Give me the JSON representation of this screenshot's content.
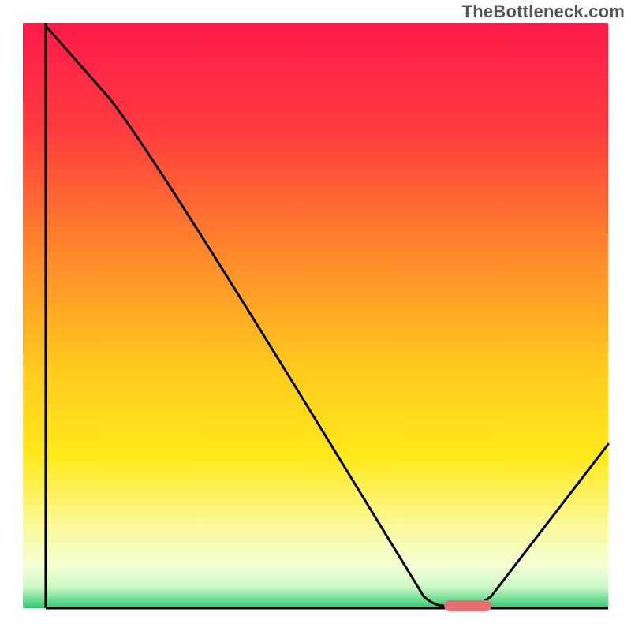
{
  "watermark": "TheBottleneck.com",
  "chart_data": {
    "type": "line",
    "title": "",
    "xlabel": "",
    "ylabel": "",
    "x_range": [
      0,
      100
    ],
    "y_range": [
      0,
      100
    ],
    "gradient_stops": [
      {
        "offset": 0.0,
        "color": "#ff1a4a"
      },
      {
        "offset": 0.18,
        "color": "#ff3a3f"
      },
      {
        "offset": 0.4,
        "color": "#ff8a2a"
      },
      {
        "offset": 0.58,
        "color": "#ffc71f"
      },
      {
        "offset": 0.74,
        "color": "#ffe91a"
      },
      {
        "offset": 0.86,
        "color": "#fbf99a"
      },
      {
        "offset": 0.93,
        "color": "#f3ffd6"
      },
      {
        "offset": 0.965,
        "color": "#c9f7c4"
      },
      {
        "offset": 1.0,
        "color": "#2ecc71"
      }
    ],
    "curve": {
      "name": "bottleneck",
      "x": [
        3.9,
        22,
        68.5,
        72,
        76,
        80,
        100
      ],
      "y": [
        99.5,
        78,
        2.0,
        0.4,
        0.4,
        2.0,
        28
      ]
    },
    "optimal_band": {
      "x_start": 72,
      "x_end": 80,
      "y": 0.4
    },
    "axes": {
      "left": {
        "x": 3.9,
        "y0": 0,
        "y1": 100
      },
      "bottom": {
        "y": 0,
        "x0": 3.9,
        "x1": 100
      }
    }
  },
  "layout": {
    "inner_left": 29,
    "inner_top": 29,
    "inner_width": 742,
    "inner_height": 742
  }
}
